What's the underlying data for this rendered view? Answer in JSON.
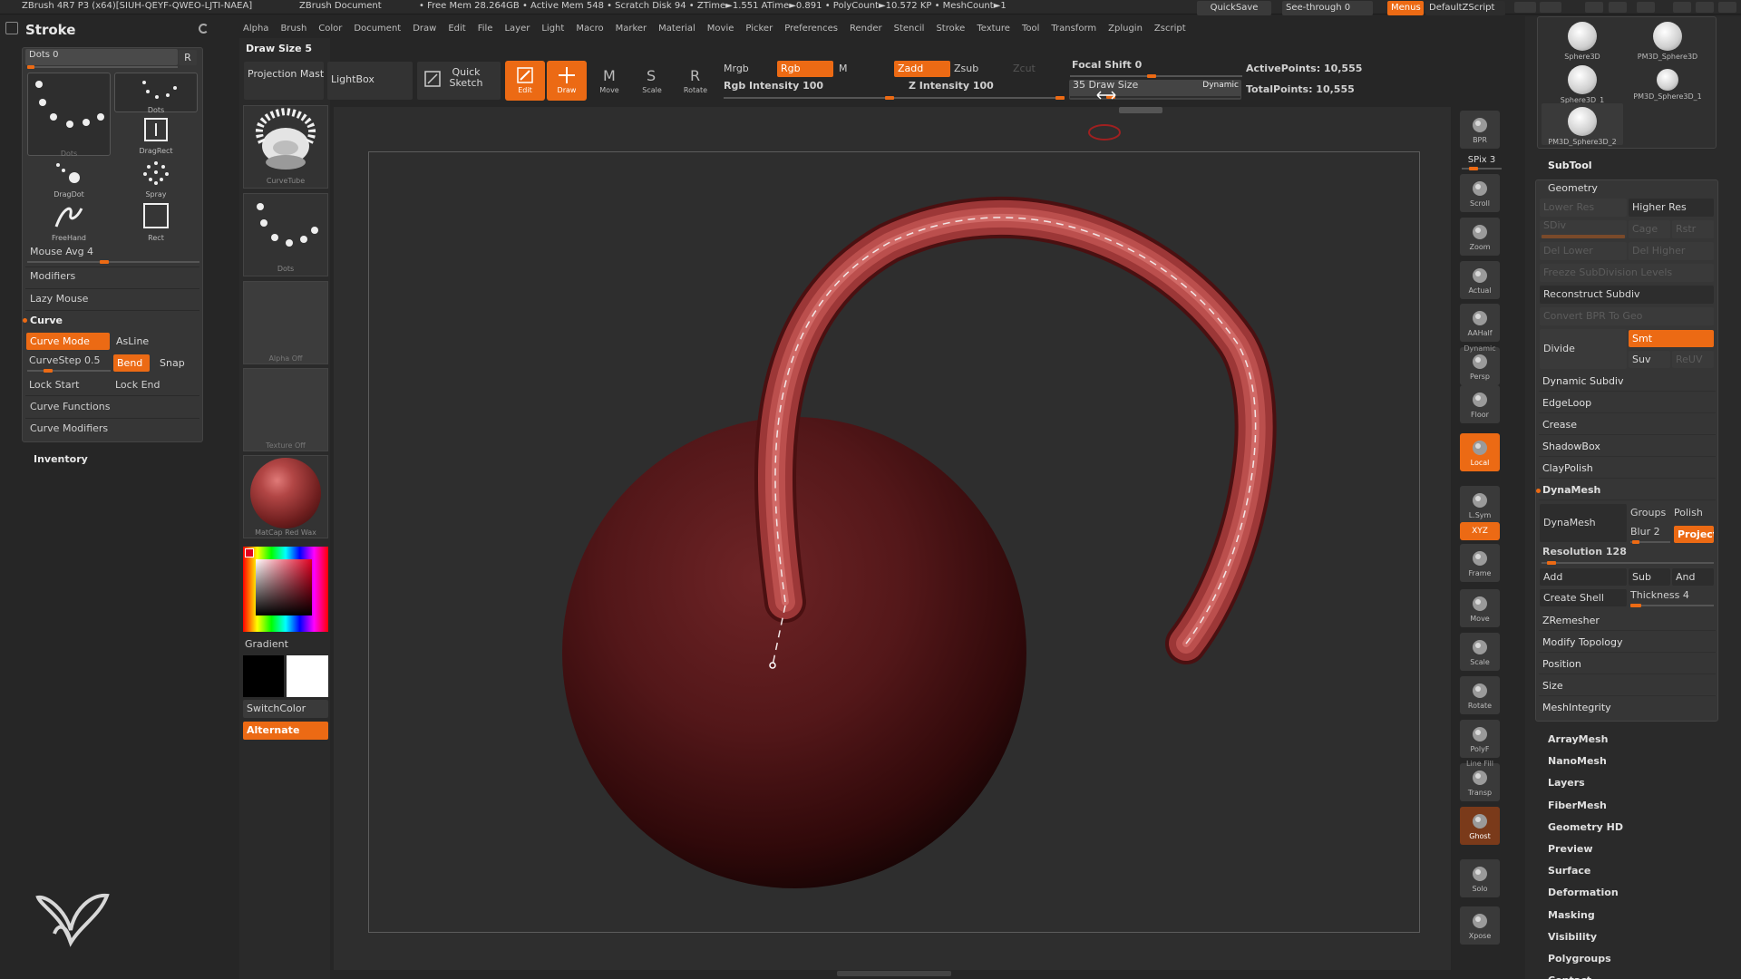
{
  "titlebar": {
    "title": "ZBrush 4R7 P3 (x64)[SIUH-QEYF-QWEO-LJTI-NAEA]",
    "doc": "ZBrush Document",
    "stats": "• Free Mem 28.264GB • Active Mem 548 • Scratch Disk 94 • ZTime►1.551 ATime►0.891 • PolyCount►10.572 KP • MeshCount►1",
    "quicksave": "QuickSave",
    "seethrough": "See-through 0",
    "menus": "Menus",
    "script": "DefaultZScript"
  },
  "menubar": [
    "Alpha",
    "Brush",
    "Color",
    "Document",
    "Draw",
    "Edit",
    "File",
    "Layer",
    "Light",
    "Macro",
    "Marker",
    "Material",
    "Movie",
    "Picker",
    "Preferences",
    "Render",
    "Stencil",
    "Stroke",
    "Texture",
    "Tool",
    "Transform",
    "Zplugin",
    "Zscript"
  ],
  "drawsize_label": "Draw Size 5",
  "toolbar": {
    "projection_master": "Projection Master",
    "lightbox": "LightBox",
    "quick_sketch": "Quick Sketch",
    "edit": "Edit",
    "draw": "Draw",
    "move": "Move",
    "scale": "Scale",
    "rotate": "Rotate",
    "mrgb": "Mrgb",
    "rgb": "Rgb",
    "m": "M",
    "rgb_intensity": "Rgb Intensity 100",
    "zadd": "Zadd",
    "zsub": "Zsub",
    "zcut": "Zcut",
    "z_intensity": "Z Intensity 100",
    "focal_shift": "Focal Shift 0",
    "draw_size": "35 Draw Size",
    "dynamic": "Dynamic",
    "active_points": "ActivePoints: 10,555",
    "total_points": "TotalPoints: 10,555",
    "rgb_intensity_value": 100,
    "z_intensity_value": 100,
    "focal_shift_value": 0,
    "draw_size_value": 35
  },
  "stroke": {
    "title": "Stroke",
    "dots_label": "Dots 0",
    "r_btn": "R",
    "thumbs": [
      "Dots",
      "Dots",
      "DragRect",
      "DragDot",
      "Spray",
      "FreeHand",
      "Rect"
    ],
    "mouse_avg": "Mouse Avg 4",
    "modifiers": "Modifiers",
    "lazy_mouse": "Lazy Mouse",
    "curve": "Curve",
    "curve_mode": "Curve Mode",
    "asline": "AsLine",
    "curvestep": "CurveStep 0.5",
    "bend": "Bend",
    "snap": "Snap",
    "lock_start": "Lock Start",
    "lock_end": "Lock End",
    "curve_functions": "Curve Functions",
    "curve_modifiers": "Curve Modifiers",
    "inventory": "Inventory"
  },
  "leftshelf": {
    "brush": "CurveTube",
    "stroke": "Dots",
    "alpha": "Alpha Off",
    "texture": "Texture Off",
    "material": "MatCap Red Wax",
    "gradient": "Gradient",
    "switchcolor": "SwitchColor",
    "alternate": "Alternate"
  },
  "rightshelf": [
    {
      "name": "bpr-icon",
      "label": "BPR"
    },
    {
      "name": "spix",
      "label": "SPix 3"
    },
    {
      "name": "scroll-icon",
      "label": "Scroll"
    },
    {
      "name": "zoom-icon",
      "label": "Zoom"
    },
    {
      "name": "actual-icon",
      "label": "Actual"
    },
    {
      "name": "aahalf-icon",
      "label": "AAHalf"
    },
    {
      "name": "persp-icon",
      "label": "Persp"
    },
    {
      "name": "floor-icon",
      "label": "Floor"
    },
    {
      "name": "local-icon",
      "label": "Local"
    },
    {
      "name": "lsym-icon",
      "label": "L.Sym"
    },
    {
      "name": "xyz-icon",
      "label": "XYZ"
    },
    {
      "name": "frame-icon",
      "label": "Frame"
    },
    {
      "name": "move-icon",
      "label": "Move"
    },
    {
      "name": "scale-icon",
      "label": "Scale"
    },
    {
      "name": "rotate-icon",
      "label": "Rotate"
    },
    {
      "name": "polyf-icon",
      "label": "PolyF"
    },
    {
      "name": "transp-icon",
      "label": "Transp"
    },
    {
      "name": "ghost-icon",
      "label": "Ghost"
    },
    {
      "name": "solo-icon",
      "label": "Solo"
    },
    {
      "name": "xpose-icon",
      "label": "Xpose"
    }
  ],
  "rightshelf_extra": {
    "dynamic": "Dynamic",
    "linefill": "Line Fill"
  },
  "subtools": [
    "Sphere3D",
    "PM3D_Sphere3D",
    "Sphere3D_1",
    "PM3D_Sphere3D_1",
    "PM3D_Sphere3D_2"
  ],
  "tool": {
    "subtool": "SubTool",
    "geometry": "Geometry",
    "lower_res": "Lower Res",
    "higher_res": "Higher Res",
    "sdiv": "SDiv",
    "cage": "Cage",
    "rstr": "Rstr",
    "del_lower": "Del Lower",
    "del_higher": "Del Higher",
    "freeze": "Freeze SubDivision Levels",
    "reconstruct": "Reconstruct Subdiv",
    "convert_bpr": "Convert BPR To Geo",
    "divide": "Divide",
    "smt": "Smt",
    "suv": "Suv",
    "reuv": "ReUV",
    "dynamic_subdiv": "Dynamic Subdiv",
    "edgeloop": "EdgeLoop",
    "crease": "Crease",
    "shadowbox": "ShadowBox",
    "claypolish": "ClayPolish",
    "dynamesh_header": "DynaMesh",
    "dynamesh": "DynaMesh",
    "groups": "Groups",
    "polish": "Polish",
    "blur": "Blur 2",
    "project": "Project",
    "resolution": "Resolution 128",
    "add": "Add",
    "sub": "Sub",
    "and": "And",
    "create_shell": "Create Shell",
    "thickness": "Thickness 4",
    "zremesher": "ZRemesher",
    "modify_topology": "Modify Topology",
    "position": "Position",
    "size": "Size",
    "meshintegrity": "MeshIntegrity",
    "sections": [
      "ArrayMesh",
      "NanoMesh",
      "Layers",
      "FiberMesh",
      "Geometry HD",
      "Preview",
      "Surface",
      "Deformation",
      "Masking",
      "Visibility",
      "Polygroups",
      "Contact"
    ]
  },
  "colors": {
    "accent": "#ec6a14",
    "bg": "#262626",
    "panel": "#363636",
    "canvas": "#2e2e2e",
    "tube": "#b24645"
  }
}
